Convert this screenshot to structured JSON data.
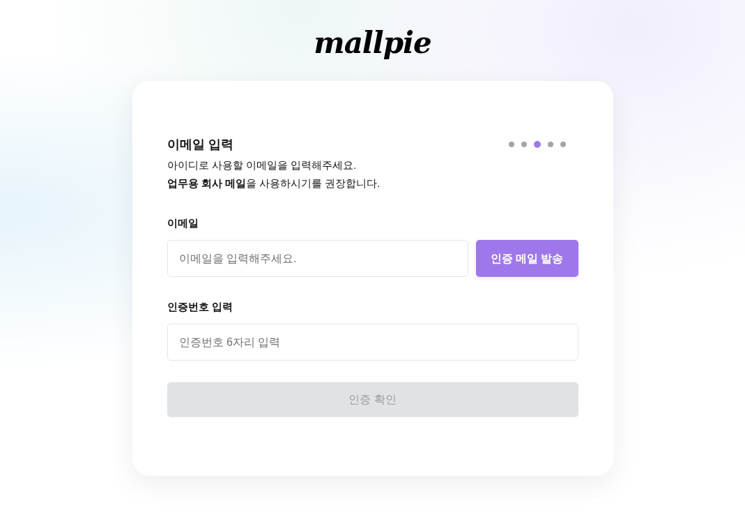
{
  "logo": "mallpie",
  "form": {
    "title": "이메일 입력",
    "description": [
      "아이디로 사용할 이메일을 입력해주세요.",
      "**업무용 회사 메일**을 사용하시기를 권장합니다."
    ],
    "steps": [
      {
        "selected": false
      },
      {
        "selected": false
      },
      {
        "selected": true
      },
      {
        "selected": false
      },
      {
        "selected": false
      }
    ],
    "email_field": {
      "label": "이메일",
      "placeholder": "이메일을 입력해주세요."
    },
    "send_button": {
      "label": "인증 메일 발송",
      "disabled": false
    },
    "code_field": {
      "label": "인증번호 입력",
      "placeholder": "인증번호 6자리 입력"
    },
    "confirm_button": {
      "label": "인증 확인",
      "disabled": true
    }
  }
}
